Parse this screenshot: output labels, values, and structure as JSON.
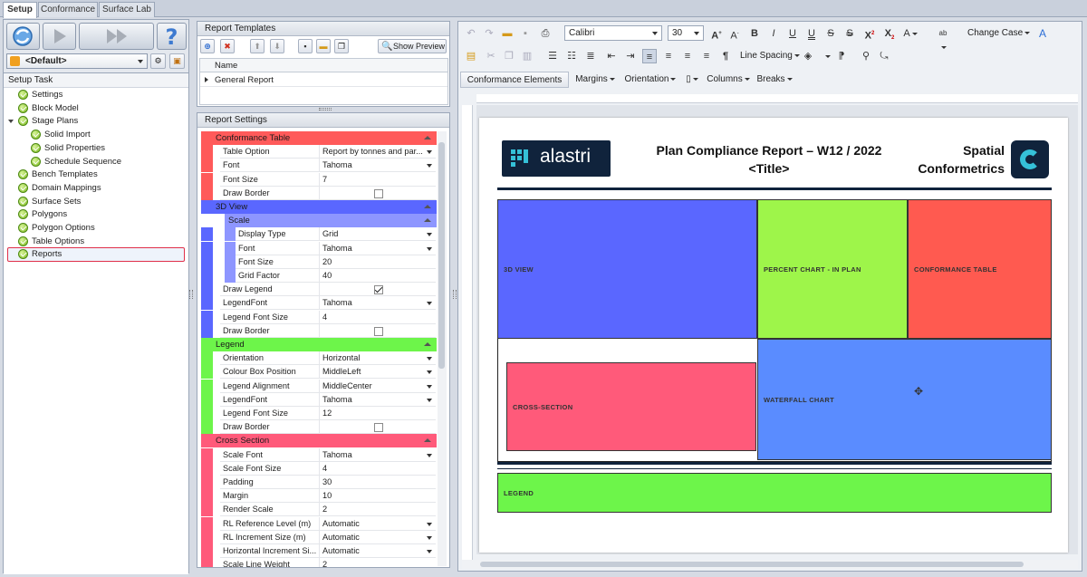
{
  "tabs": [
    "Setup",
    "Conformance",
    "Surface Lab"
  ],
  "profile": {
    "selected": "<Default>"
  },
  "setup_task": {
    "header": "Setup Task",
    "items": [
      {
        "label": "Settings",
        "indent": 0
      },
      {
        "label": "Block Model",
        "indent": 0
      },
      {
        "label": "Stage Plans",
        "indent": 0
      },
      {
        "label": "Solid Import",
        "indent": 1
      },
      {
        "label": "Solid Properties",
        "indent": 1
      },
      {
        "label": "Schedule Sequence",
        "indent": 1
      },
      {
        "label": "Bench Templates",
        "indent": 0
      },
      {
        "label": "Domain Mappings",
        "indent": 0
      },
      {
        "label": "Surface Sets",
        "indent": 0
      },
      {
        "label": "Polygons",
        "indent": 0
      },
      {
        "label": "Polygon Options",
        "indent": 0
      },
      {
        "label": "Table Options",
        "indent": 0
      },
      {
        "label": "Reports",
        "indent": 0
      }
    ]
  },
  "report_templates": {
    "header": "Report Templates",
    "show_preview": "Show Preview",
    "column": "Name",
    "rows": [
      "General Report"
    ]
  },
  "report_settings": {
    "header": "Report Settings",
    "sections": [
      {
        "name": "Conformance Table",
        "color": "#ff5a5a",
        "rows": [
          {
            "label": "Table Option",
            "value": "Report by tonnes and par...",
            "type": "dd"
          },
          {
            "label": "Font",
            "value": "Tahoma",
            "type": "dd"
          },
          {
            "label": "Font Size",
            "value": "7",
            "type": "text"
          },
          {
            "label": "Draw Border",
            "value": "",
            "type": "cb",
            "checked": false
          }
        ]
      },
      {
        "name": "3D View",
        "color": "#5a67ff",
        "rows": [
          {
            "label": "Display Type",
            "value": "Grid",
            "type": "dd",
            "sub": true
          },
          {
            "label": "Font",
            "value": "Tahoma",
            "type": "dd",
            "sub": true
          },
          {
            "label": "Font Size",
            "value": "20",
            "type": "text",
            "sub": true
          },
          {
            "label": "Grid Factor",
            "value": "40",
            "type": "text",
            "sub": true
          },
          {
            "label": "Draw Legend",
            "value": "",
            "type": "cb",
            "checked": true
          },
          {
            "label": "LegendFont",
            "value": "Tahoma",
            "type": "dd"
          },
          {
            "label": "Legend Font Size",
            "value": "4",
            "type": "text"
          },
          {
            "label": "Draw Border",
            "value": "",
            "type": "cb",
            "checked": false
          }
        ],
        "subsection": "Scale"
      },
      {
        "name": "Legend",
        "color": "#6df54a",
        "rows": [
          {
            "label": "Orientation",
            "value": "Horizontal",
            "type": "dd"
          },
          {
            "label": "Colour Box Position",
            "value": "MiddleLeft",
            "type": "dd"
          },
          {
            "label": "Legend Alignment",
            "value": "MiddleCenter",
            "type": "dd"
          },
          {
            "label": "LegendFont",
            "value": "Tahoma",
            "type": "dd"
          },
          {
            "label": "Legend Font Size",
            "value": "12",
            "type": "text"
          },
          {
            "label": "Draw Border",
            "value": "",
            "type": "cb",
            "checked": false
          }
        ]
      },
      {
        "name": "Cross Section",
        "color": "#ff5a7a",
        "rows": [
          {
            "label": "Scale Font",
            "value": "Tahoma",
            "type": "dd"
          },
          {
            "label": "Scale Font Size",
            "value": "4",
            "type": "text"
          },
          {
            "label": "Padding",
            "value": "30",
            "type": "text"
          },
          {
            "label": "Margin",
            "value": "10",
            "type": "text"
          },
          {
            "label": "Render Scale",
            "value": "2",
            "type": "text"
          },
          {
            "label": "RL Reference Level (m)",
            "value": "Automatic",
            "type": "dd"
          },
          {
            "label": "RL Increment Size (m)",
            "value": "Automatic",
            "type": "dd"
          },
          {
            "label": "Horizontal Increment Si...",
            "value": "Automatic",
            "type": "dd"
          },
          {
            "label": "Scale Line Weight",
            "value": "2",
            "type": "text"
          }
        ]
      }
    ]
  },
  "editor": {
    "font_name": "Calibri",
    "font_size": "30",
    "change_case": "Change Case",
    "line_spacing": "Line Spacing",
    "menus": [
      "Conformance Elements",
      "Margins",
      "Orientation",
      "Columns",
      "Breaks"
    ]
  },
  "document": {
    "logo_text": "alastri",
    "title_line1": "Plan Compliance Report – W12 / 2022",
    "title_line2": "<Title>",
    "brand_line1": "Spatial",
    "brand_line2": "Conformetrics",
    "blocks": {
      "view3d": "3D VIEW",
      "percent": "PERCENT CHART - IN PLAN",
      "conformance": "CONFORMANCE TABLE",
      "cross": "CROSS-SECTION",
      "waterfall": "WATERFALL CHART",
      "legend": "LEGEND"
    },
    "colors": {
      "view3d": "#5a67ff",
      "percent": "#9ef54a",
      "conformance": "#ff5a50",
      "cross": "#ff5a7a",
      "waterfall": "#5a8cff",
      "legend": "#6df54a"
    }
  }
}
